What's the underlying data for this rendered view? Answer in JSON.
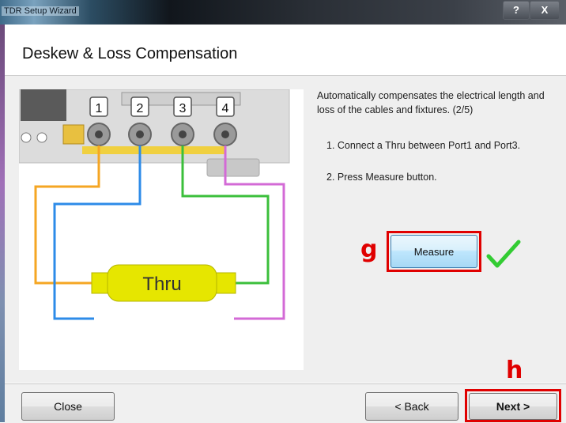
{
  "window": {
    "title": "TDR Setup Wizard",
    "help_label": "?",
    "close_label": "X"
  },
  "header": {
    "title": "Deskew & Loss Compensation"
  },
  "diagram": {
    "ports": [
      "1",
      "2",
      "3",
      "4"
    ],
    "thru_label": "Thru",
    "colors": {
      "port1": "#f5a623",
      "port2": "#2d8be8",
      "port3": "#3bbf3b",
      "port4": "#d36ad6",
      "thru": "#e6e600"
    }
  },
  "instructions": {
    "description": "Automatically compensates the electrical length and loss of the cables and fixtures.  (2/5)",
    "step1": "1. Connect a Thru between Port1 and Port3.",
    "step2": "2. Press Measure button."
  },
  "measure": {
    "label": "Measure",
    "check_icon": "check-icon",
    "check_color": "#33cc33"
  },
  "annotations": {
    "g": "g",
    "h": "h",
    "color": "#e00000"
  },
  "footer": {
    "close_label": "Close",
    "back_label": "< Back",
    "next_label": "Next >"
  }
}
